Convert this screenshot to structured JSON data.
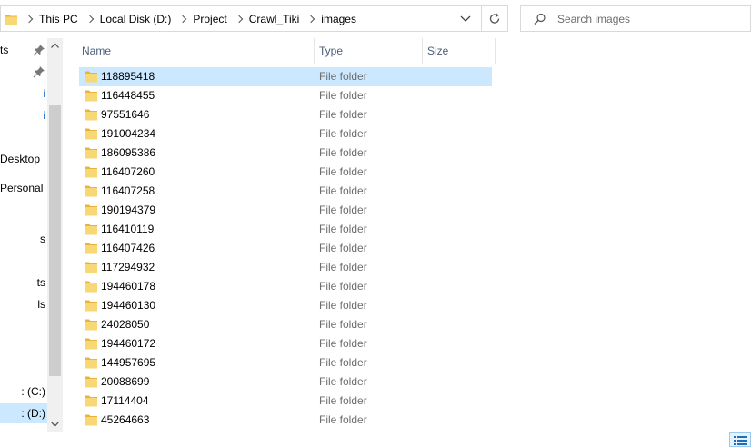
{
  "address_bar": {
    "crumbs": [
      "This PC",
      "Local Disk (D:)",
      "Project",
      "Crawl_Tiki",
      "images"
    ],
    "folder_icon": "folder-icon",
    "dropdown_icon": "chevron-down-icon",
    "refresh_icon": "refresh-icon"
  },
  "search": {
    "placeholder": "Search images",
    "icon": "search-icon"
  },
  "nav_pane": {
    "items": [
      {
        "label": "ts",
        "pinned": true
      },
      {
        "label": "",
        "pinned": true
      },
      {
        "label": "i",
        "link": true
      },
      {
        "label": "i",
        "link": true
      },
      {
        "label": "Desktop"
      },
      {
        "label": "Personal"
      },
      {
        "label": "s"
      },
      {
        "label": "ts"
      },
      {
        "label": "ls"
      },
      {
        "label": ": (C:)"
      },
      {
        "label": ": (D:)",
        "selected": true
      }
    ]
  },
  "file_list": {
    "columns": [
      "Name",
      "Type",
      "Size"
    ],
    "rows": [
      {
        "name": "118895418",
        "type": "File folder",
        "selected": true
      },
      {
        "name": "116448455",
        "type": "File folder"
      },
      {
        "name": "97551646",
        "type": "File folder"
      },
      {
        "name": "191004234",
        "type": "File folder"
      },
      {
        "name": "186095386",
        "type": "File folder"
      },
      {
        "name": "116407260",
        "type": "File folder"
      },
      {
        "name": "116407258",
        "type": "File folder"
      },
      {
        "name": "190194379",
        "type": "File folder"
      },
      {
        "name": "116410119",
        "type": "File folder"
      },
      {
        "name": "116407426",
        "type": "File folder"
      },
      {
        "name": "117294932",
        "type": "File folder"
      },
      {
        "name": "194460178",
        "type": "File folder"
      },
      {
        "name": "194460130",
        "type": "File folder"
      },
      {
        "name": "24028050",
        "type": "File folder"
      },
      {
        "name": "194460172",
        "type": "File folder"
      },
      {
        "name": "144957695",
        "type": "File folder"
      },
      {
        "name": "20088699",
        "type": "File folder"
      },
      {
        "name": "17114404",
        "type": "File folder"
      },
      {
        "name": "45264663",
        "type": "File folder"
      }
    ]
  },
  "colors": {
    "folder": "#f8d775",
    "folder_dark": "#e8b53c",
    "selection": "#cce8ff",
    "header_text": "#4c607a",
    "link": "#0a64c8"
  },
  "view_toggle_icon": "details-view-icon"
}
